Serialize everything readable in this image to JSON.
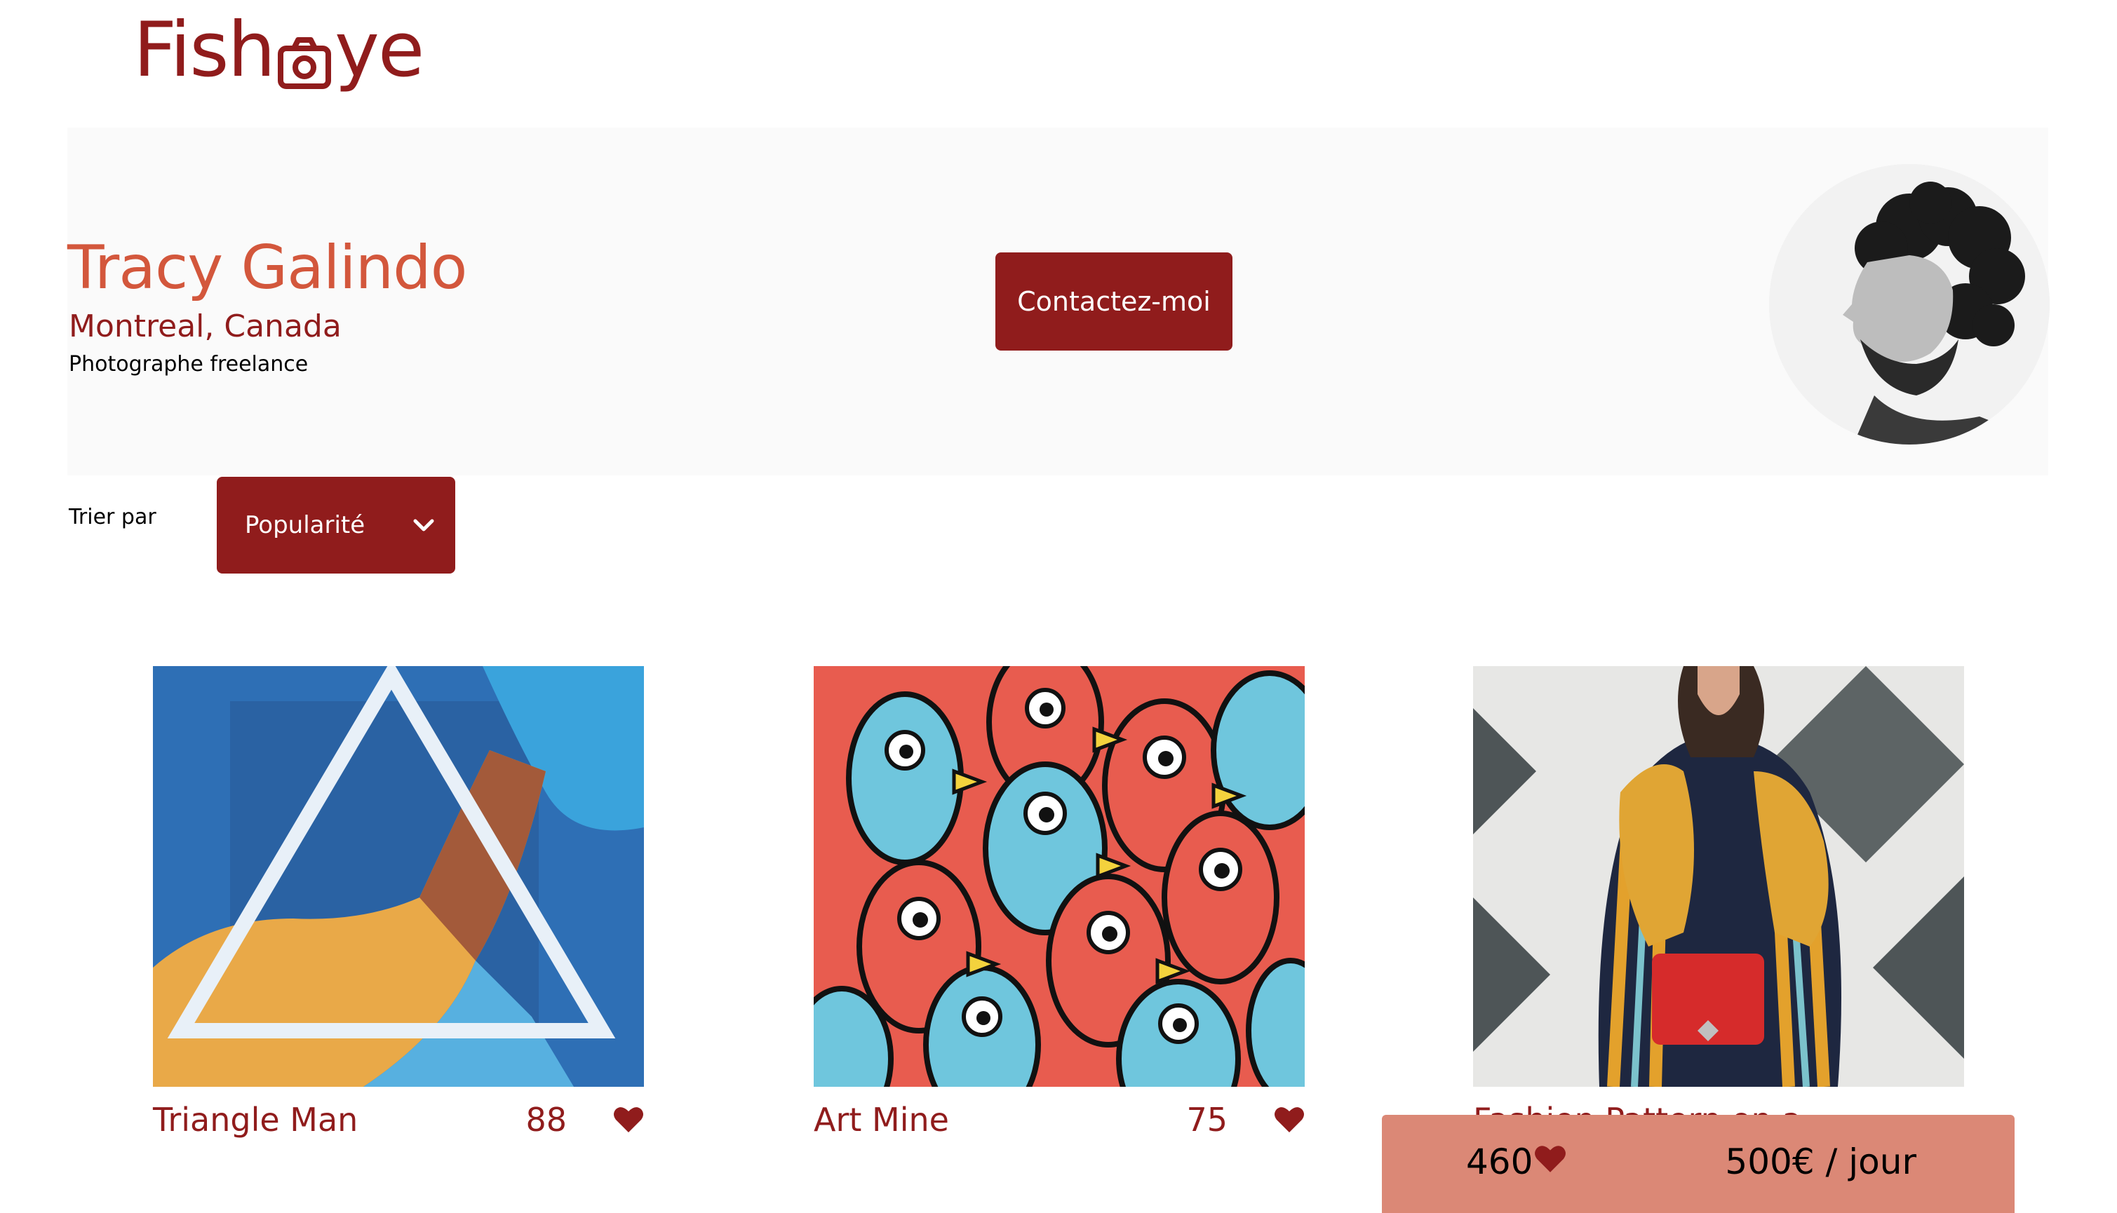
{
  "logo": {
    "text_before": "Fish",
    "text_after": "ye",
    "icon": "camera-icon"
  },
  "photographer": {
    "name": "Tracy Galindo",
    "location": "Montreal, Canada",
    "tagline": "Photographe freelance",
    "contact_label": "Contactez-moi",
    "avatar_icon": "portrait-photo"
  },
  "sort": {
    "label": "Trier par",
    "selected": "Popularité",
    "icon": "chevron-down-icon"
  },
  "gallery": [
    {
      "title": "Triangle Man",
      "likes": "88",
      "icon": "heart-icon"
    },
    {
      "title": "Art Mine",
      "likes": "75",
      "icon": "heart-icon"
    },
    {
      "title": "Fashion Pattern on a",
      "likes": "",
      "icon": "heart-icon"
    }
  ],
  "info_bar": {
    "total_likes": "460",
    "price": "500€ / jour",
    "icon": "heart-icon"
  },
  "colors": {
    "primary": "#901c1c",
    "secondary": "#d3573c",
    "info_bar": "#db8876",
    "header_bg": "#fafafa"
  }
}
